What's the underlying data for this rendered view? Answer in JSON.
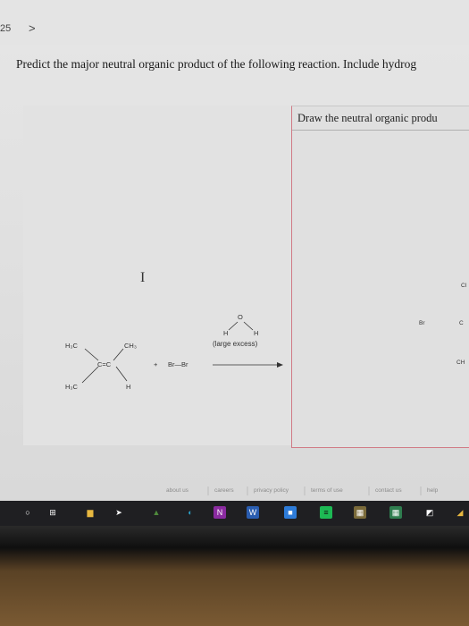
{
  "header": {
    "question_number": "25",
    "next_symbol": ">"
  },
  "question": {
    "text": "Predict the major neutral organic product of the following reaction. Include hydrog"
  },
  "draw_panel": {
    "title": "Draw the neutral organic produ",
    "partial_labels": {
      "top": "Cl",
      "left": "Br",
      "middle": "C",
      "bottom": "CH"
    }
  },
  "cursor": {
    "symbol": "I"
  },
  "reaction": {
    "alkene": {
      "top_left": "H₃C",
      "top_right": "CH₃",
      "center": "C=C",
      "bottom_left": "H₃C",
      "bottom_right": "H"
    },
    "plus": "+",
    "reagent": "Br—Br",
    "water": {
      "left_h": "H",
      "o": "O",
      "right_h": "H"
    },
    "condition": "(large excess)"
  },
  "footer_links": [
    "about us",
    "careers",
    "privacy policy",
    "terms of use",
    "contact us",
    "help"
  ],
  "taskbar": {
    "apps": [
      {
        "name": "start",
        "glyph": "○",
        "color": "#ffffff"
      },
      {
        "name": "task-view",
        "glyph": "⊞",
        "color": "#ffffff"
      },
      {
        "name": "file-explorer",
        "glyph": "▆",
        "color": "#e8b840"
      },
      {
        "name": "browser-arrow",
        "glyph": "➤",
        "color": "#ffffff"
      },
      {
        "name": "store",
        "glyph": "▲",
        "color": "#4f8a3c"
      },
      {
        "name": "edge",
        "glyph": "◐",
        "color": "#2aa0c8"
      },
      {
        "name": "onenote",
        "glyph": "N",
        "color": "#ffffff",
        "bg": "#8a2ba0"
      },
      {
        "name": "word",
        "glyph": "W",
        "color": "#ffffff",
        "bg": "#2a5db0"
      },
      {
        "name": "zoom",
        "glyph": "■",
        "color": "#ffffff",
        "bg": "#2d7bd8"
      },
      {
        "name": "spotify",
        "glyph": "≡",
        "color": "#111111",
        "bg": "#1db954"
      },
      {
        "name": "calendar",
        "glyph": "▦",
        "color": "#ffffff",
        "bg": "#7a6a3a"
      },
      {
        "name": "calculator",
        "glyph": "▦",
        "color": "#ffffff",
        "bg": "#2f7d4f"
      },
      {
        "name": "photos",
        "glyph": "◩",
        "color": "#ffffff"
      },
      {
        "name": "edge-overflow",
        "glyph": "◢",
        "color": "#e8b840"
      }
    ]
  }
}
